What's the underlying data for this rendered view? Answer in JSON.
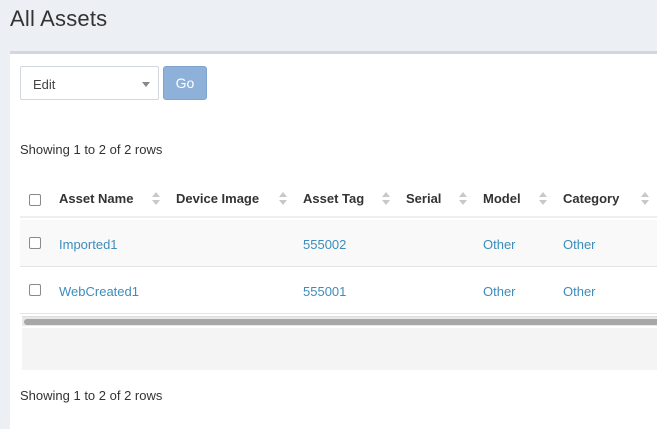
{
  "page": {
    "title": "All Assets"
  },
  "toolbar": {
    "bulk_action_selected": "Edit",
    "go_label": "Go"
  },
  "pagination": {
    "top_text": "Showing 1 to 2 of 2 rows",
    "bottom_text": "Showing 1 to 2 of 2 rows"
  },
  "table": {
    "columns": [
      "Asset Name",
      "Device Image",
      "Asset Tag",
      "Serial",
      "Model",
      "Category"
    ],
    "rows": [
      {
        "asset_name": "Imported1",
        "device_image": "",
        "asset_tag": "555002",
        "serial": "",
        "model": "Other",
        "category": "Other"
      },
      {
        "asset_name": "WebCreated1",
        "device_image": "",
        "asset_tag": "555001",
        "serial": "",
        "model": "Other",
        "category": "Other"
      }
    ]
  },
  "colors": {
    "link": "#3c8dbc",
    "go_button": "#8eb1d9",
    "background": "#ecf0f5"
  }
}
